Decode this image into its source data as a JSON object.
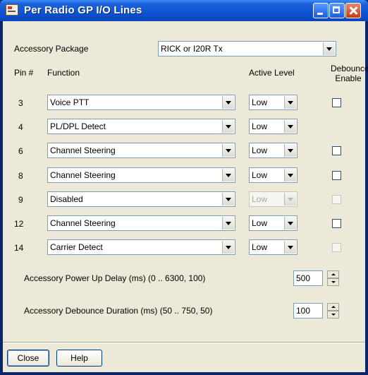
{
  "window": {
    "title": "Per Radio GP I/O Lines"
  },
  "accessory_package": {
    "label": "Accessory Package",
    "value": "RICK or I20R Tx"
  },
  "headers": {
    "pin": "Pin #",
    "function": "Function",
    "active_level": "Active Level",
    "debounce_line1": "Debounce",
    "debounce_line2": "Enable"
  },
  "rows": [
    {
      "pin": "3",
      "function": "Voice PTT",
      "level": "Low",
      "level_enabled": true,
      "debounce": "enabled"
    },
    {
      "pin": "4",
      "function": "PL/DPL Detect",
      "level": "Low",
      "level_enabled": true,
      "debounce": "none"
    },
    {
      "pin": "6",
      "function": "Channel Steering",
      "level": "Low",
      "level_enabled": true,
      "debounce": "enabled"
    },
    {
      "pin": "8",
      "function": "Channel Steering",
      "level": "Low",
      "level_enabled": true,
      "debounce": "enabled"
    },
    {
      "pin": "9",
      "function": "Disabled",
      "level": "Low",
      "level_enabled": false,
      "debounce": "disabled"
    },
    {
      "pin": "12",
      "function": "Channel Steering",
      "level": "Low",
      "level_enabled": true,
      "debounce": "enabled"
    },
    {
      "pin": "14",
      "function": "Carrier Detect",
      "level": "Low",
      "level_enabled": true,
      "debounce": "disabled"
    }
  ],
  "power_up_delay": {
    "label": "Accessory Power Up Delay (ms) (0 .. 6300, 100)",
    "value": "500"
  },
  "debounce_duration": {
    "label": "Accessory Debounce Duration (ms) (50 .. 750, 50)",
    "value": "100"
  },
  "buttons": {
    "close": "Close",
    "help": "Help"
  },
  "colors": {
    "titlebar": "#0e52d0",
    "dialog_bg": "#ece9d8",
    "field_border": "#7f9db9"
  }
}
